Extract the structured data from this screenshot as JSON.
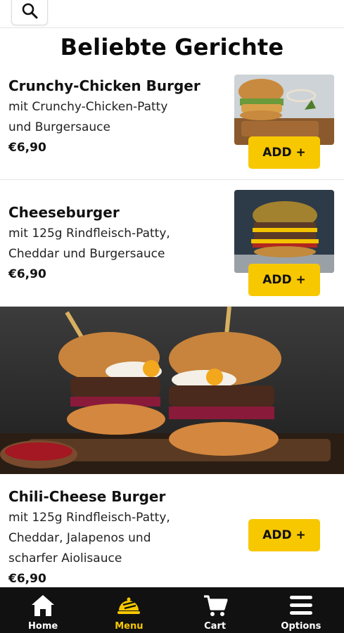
{
  "section_title": "Beliebte Gerichte",
  "items": [
    {
      "name": "Crunchy-Chicken Burger",
      "desc_line1": "mit Crunchy-Chicken-Patty",
      "desc_line2": "und Burgersauce",
      "price": "€6,90",
      "add_label": "ADD +"
    },
    {
      "name": "Cheeseburger",
      "desc_line1": "mit 125g Rindfleisch-Patty,",
      "desc_line2": "Cheddar und Burgersauce",
      "price": "€6,90",
      "add_label": "ADD +"
    },
    {
      "name": "Chili-Cheese Burger",
      "desc_line1": "mit 125g Rindfleisch-Patty,",
      "desc_line2": "Cheddar, Jalapenos und",
      "desc_line3": "scharfer Aiolisauce",
      "price": "€6,90",
      "add_label": "ADD +"
    }
  ],
  "nav": [
    {
      "label": "Home",
      "icon": "home-icon",
      "active": false
    },
    {
      "label": "Menu",
      "icon": "menu-icon",
      "active": true
    },
    {
      "label": "Cart",
      "icon": "cart-icon",
      "active": false
    },
    {
      "label": "Options",
      "icon": "options-icon",
      "active": false
    }
  ],
  "colors": {
    "accent": "#f7c800",
    "nav_background": "#111111",
    "text": "#111111"
  }
}
